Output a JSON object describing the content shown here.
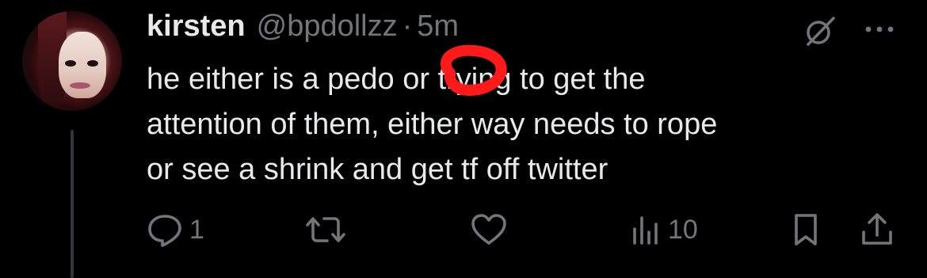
{
  "tweet": {
    "author_name": "kirsten",
    "author_handle": "@bpdollzz",
    "separator": "·",
    "timestamp": "5m",
    "text_line1": "he either is a pedo or trying to get the",
    "text_line2": "attention of them, either way needs to rope",
    "text_line3": "or see a shrink and get tf off twitter"
  },
  "actions": {
    "reply_count": "1",
    "retweet_count": "",
    "like_count": "",
    "views_count": "10"
  },
  "icons": {
    "reply": "reply-icon",
    "retweet": "retweet-icon",
    "like": "heart-icon",
    "views": "views-icon",
    "bookmark": "bookmark-icon",
    "share": "share-icon",
    "grok": "grok-icon",
    "more": "more-icon"
  },
  "colors": {
    "background": "#000000",
    "text": "#e7e9ea",
    "muted": "#71767b",
    "annotation": "#ff1a1a"
  }
}
